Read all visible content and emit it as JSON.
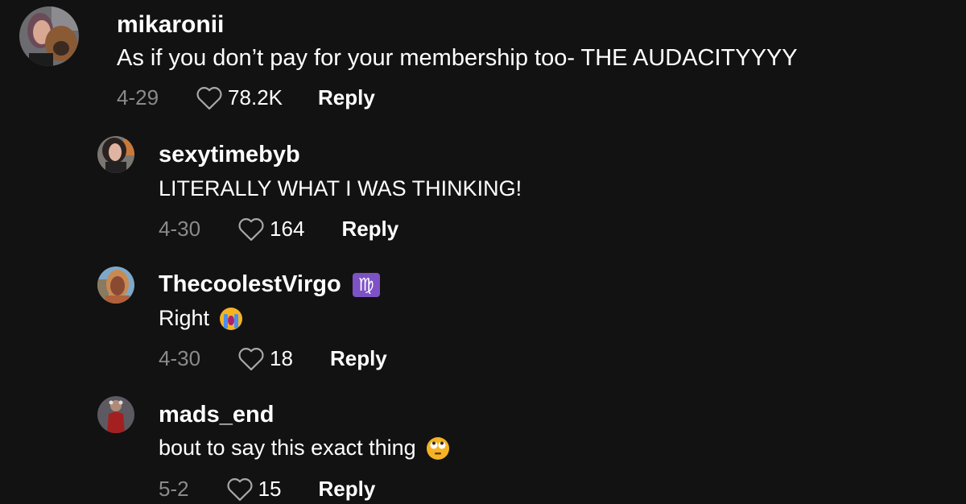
{
  "comments": [
    {
      "username": "mikaronii",
      "text": "As if you don’t pay for your membership too- THE AUDACITYYYY",
      "date": "4-29",
      "likes": "78.2K",
      "reply_label": "Reply",
      "avatar_icon": "avatar-woman-with-dog"
    },
    {
      "username": "sexytimebyb",
      "text": "LITERALLY WHAT I WAS THINKING!",
      "date": "4-30",
      "likes": "164",
      "reply_label": "Reply",
      "avatar_icon": "avatar-woman"
    },
    {
      "username": "ThecoolestVirgo",
      "badge": "♍",
      "badge_color": "#7d52c4",
      "text": "Right",
      "emoji": "loudly-crying-face",
      "date": "4-30",
      "likes": "18",
      "reply_label": "Reply",
      "avatar_icon": "avatar-woman-selfie"
    },
    {
      "username": "mads_end",
      "text": "bout to say this exact thing",
      "emoji": "face-with-rolling-eyes",
      "date": "5-2",
      "likes": "15",
      "reply_label": "Reply",
      "avatar_icon": "avatar-figure-red-jacket"
    }
  ],
  "colors": {
    "background": "#121212",
    "text": "#ffffff",
    "muted": "#8a8a8a"
  }
}
